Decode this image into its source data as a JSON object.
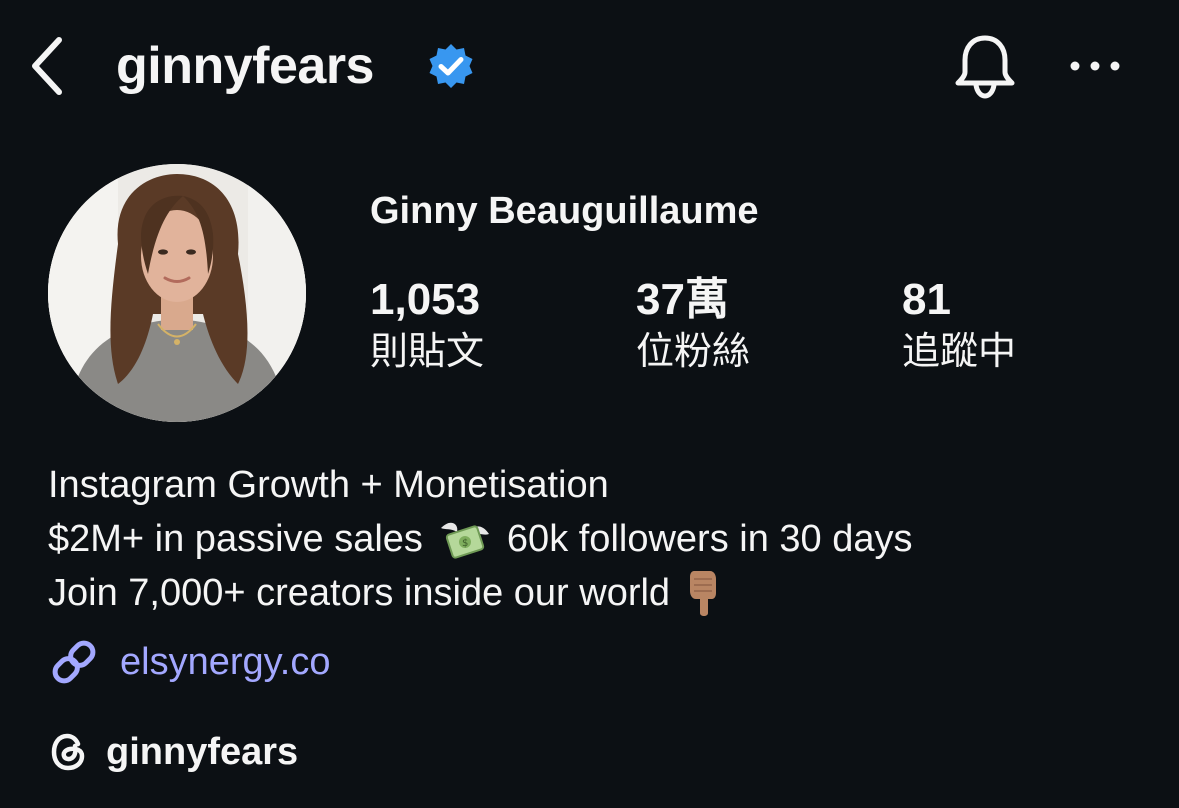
{
  "header": {
    "username": "ginnyfears",
    "verified": true,
    "verified_color": "#3897f0"
  },
  "profile": {
    "full_name": "Ginny Beauguillaume",
    "stats": [
      {
        "value": "1,053",
        "label": "則貼文"
      },
      {
        "value": "37萬",
        "label": "位粉絲"
      },
      {
        "value": "81",
        "label": "追蹤中"
      }
    ]
  },
  "bio": {
    "line1": "Instagram Growth + Monetisation",
    "line2a": "$2M+ in passive sales",
    "line2b": "60k followers in 30 days",
    "line3": "Join 7,000+ creators inside our world"
  },
  "link": {
    "text": "elsynergy.co",
    "color": "#a3a8ff",
    "icon": "link-icon"
  },
  "threads": {
    "handle": "ginnyfears",
    "icon": "threads-icon"
  },
  "icons": {
    "back": "chevron-left-icon",
    "bell": "bell-icon",
    "more": "more-horizontal-icon",
    "money": "money-with-wings-emoji",
    "pointer": "pointing-down-emoji"
  },
  "colors": {
    "background": "#0c1014",
    "text": "#f5f5f5"
  }
}
